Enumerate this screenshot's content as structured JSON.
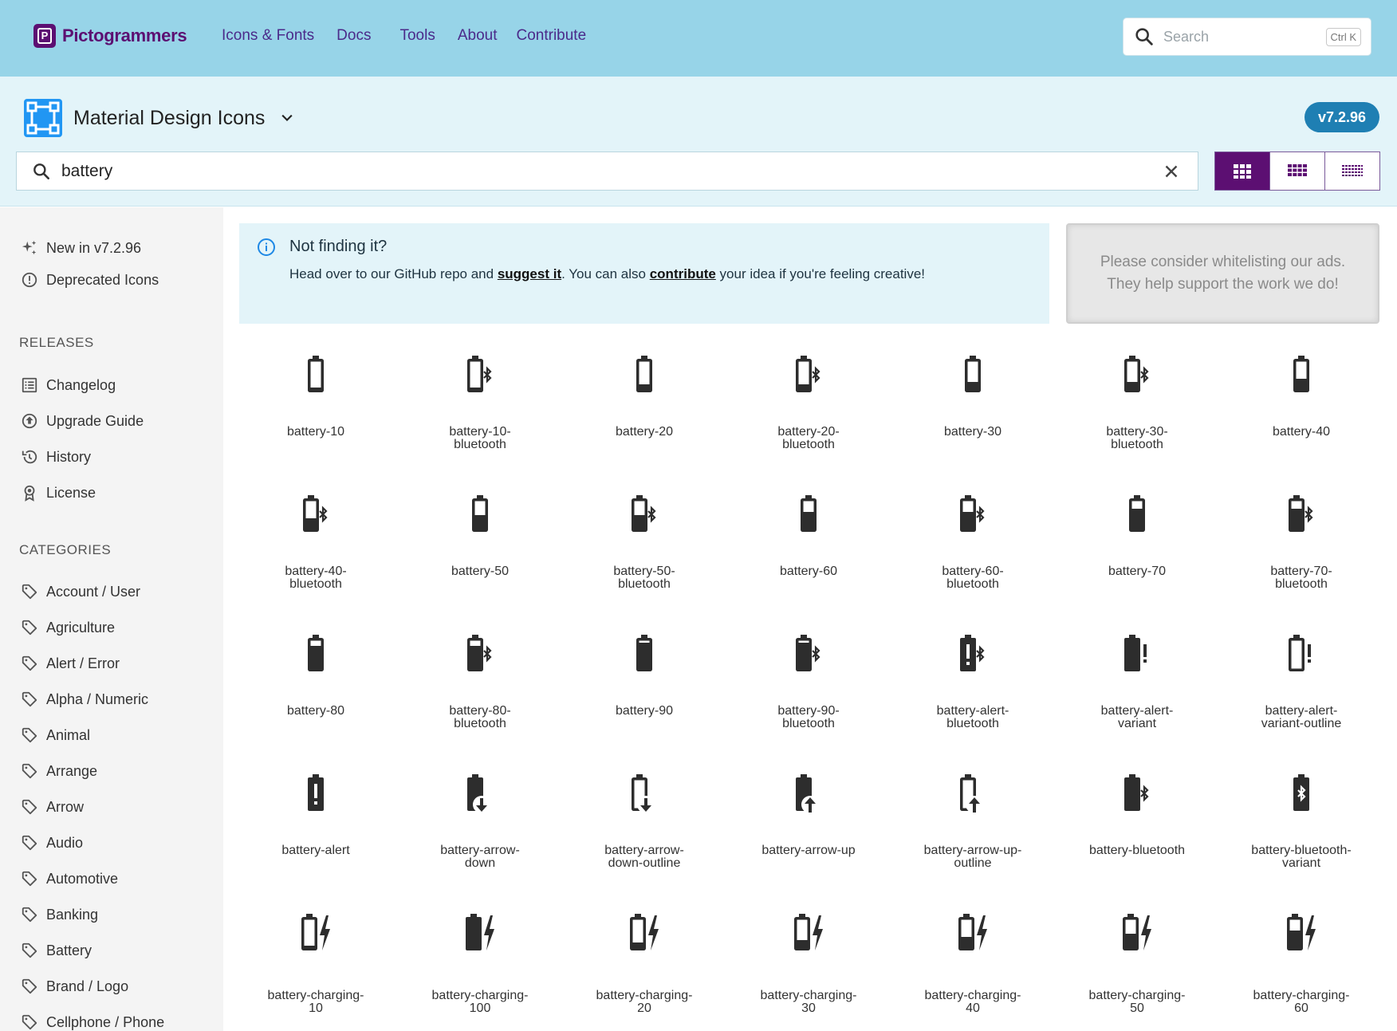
{
  "topbar": {
    "brand": "Pictogrammers",
    "nav": [
      "Icons & Fonts",
      "Docs",
      "Tools",
      "About",
      "Contribute"
    ],
    "search_placeholder": "Search",
    "search_shortcut": "Ctrl K"
  },
  "library": {
    "name": "Material Design Icons",
    "version": "v7.2.96",
    "search_value": "battery",
    "view_modes": [
      "large-grid",
      "medium-grid",
      "small-grid"
    ],
    "active_view": "large-grid"
  },
  "sidebar": {
    "top_items": [
      {
        "label": "New in v7.2.96",
        "icon": "sparkle-icon"
      },
      {
        "label": "Deprecated Icons",
        "icon": "alert-circle-icon"
      }
    ],
    "releases_heading": "RELEASES",
    "releases": [
      {
        "label": "Changelog",
        "icon": "list-icon"
      },
      {
        "label": "Upgrade Guide",
        "icon": "upgrade-icon"
      },
      {
        "label": "History",
        "icon": "history-icon"
      },
      {
        "label": "License",
        "icon": "license-icon"
      }
    ],
    "categories_heading": "CATEGORIES",
    "categories": [
      "Account / User",
      "Agriculture",
      "Alert / Error",
      "Alpha / Numeric",
      "Animal",
      "Arrange",
      "Arrow",
      "Audio",
      "Automotive",
      "Banking",
      "Battery",
      "Brand / Logo",
      "Cellphone / Phone"
    ]
  },
  "notice": {
    "title": "Not finding it?",
    "body_pre": "Head over to our GitHub repo and ",
    "link1": "suggest it",
    "body_mid": ". You can also ",
    "link2": "contribute",
    "body_post": " your idea if you're feeling creative!"
  },
  "ad": {
    "line1": "Please consider whitelisting our ads.",
    "line2": "They help support the work we do!"
  },
  "icons": [
    {
      "l1": "battery-10",
      "l2": "",
      "kind": "battery",
      "level": 1,
      "extra": ""
    },
    {
      "l1": "battery-10-",
      "l2": "bluetooth",
      "kind": "battery",
      "level": 1,
      "extra": "bt"
    },
    {
      "l1": "battery-20",
      "l2": "",
      "kind": "battery",
      "level": 2,
      "extra": ""
    },
    {
      "l1": "battery-20-",
      "l2": "bluetooth",
      "kind": "battery",
      "level": 2,
      "extra": "bt"
    },
    {
      "l1": "battery-30",
      "l2": "",
      "kind": "battery",
      "level": 3,
      "extra": ""
    },
    {
      "l1": "battery-30-",
      "l2": "bluetooth",
      "kind": "battery",
      "level": 3,
      "extra": "bt"
    },
    {
      "l1": "battery-40",
      "l2": "",
      "kind": "battery",
      "level": 4,
      "extra": ""
    },
    {
      "l1": "battery-40-",
      "l2": "bluetooth",
      "kind": "battery",
      "level": 4,
      "extra": "bt"
    },
    {
      "l1": "battery-50",
      "l2": "",
      "kind": "battery",
      "level": 5,
      "extra": ""
    },
    {
      "l1": "battery-50-",
      "l2": "bluetooth",
      "kind": "battery",
      "level": 5,
      "extra": "bt"
    },
    {
      "l1": "battery-60",
      "l2": "",
      "kind": "battery",
      "level": 6,
      "extra": ""
    },
    {
      "l1": "battery-60-",
      "l2": "bluetooth",
      "kind": "battery",
      "level": 6,
      "extra": "bt"
    },
    {
      "l1": "battery-70",
      "l2": "",
      "kind": "battery",
      "level": 7,
      "extra": ""
    },
    {
      "l1": "battery-70-",
      "l2": "bluetooth",
      "kind": "battery",
      "level": 7,
      "extra": "bt"
    },
    {
      "l1": "battery-80",
      "l2": "",
      "kind": "battery",
      "level": 8,
      "extra": ""
    },
    {
      "l1": "battery-80-",
      "l2": "bluetooth",
      "kind": "battery",
      "level": 8,
      "extra": "bt"
    },
    {
      "l1": "battery-90",
      "l2": "",
      "kind": "battery",
      "level": 9,
      "extra": ""
    },
    {
      "l1": "battery-90-",
      "l2": "bluetooth",
      "kind": "battery",
      "level": 9,
      "extra": "bt"
    },
    {
      "l1": "battery-alert-",
      "l2": "bluetooth",
      "kind": "alert",
      "level": 10,
      "extra": "bt"
    },
    {
      "l1": "battery-alert-",
      "l2": "variant",
      "kind": "battery",
      "level": 10,
      "extra": "excl"
    },
    {
      "l1": "battery-alert-",
      "l2": "variant-outline",
      "kind": "battery",
      "level": 0,
      "extra": "excl"
    },
    {
      "l1": "battery-alert",
      "l2": "",
      "kind": "alert",
      "level": 10,
      "extra": ""
    },
    {
      "l1": "battery-arrow-",
      "l2": "down",
      "kind": "battery",
      "level": 10,
      "extra": "down"
    },
    {
      "l1": "battery-arrow-",
      "l2": "down-outline",
      "kind": "battery",
      "level": 0,
      "extra": "down"
    },
    {
      "l1": "battery-arrow-up",
      "l2": "",
      "kind": "battery",
      "level": 10,
      "extra": "up"
    },
    {
      "l1": "battery-arrow-up-",
      "l2": "outline",
      "kind": "battery",
      "level": 0,
      "extra": "up"
    },
    {
      "l1": "battery-bluetooth",
      "l2": "",
      "kind": "battery",
      "level": 10,
      "extra": "bt"
    },
    {
      "l1": "battery-bluetooth-",
      "l2": "variant",
      "kind": "btvariant",
      "level": 10,
      "extra": ""
    },
    {
      "l1": "battery-charging-",
      "l2": "10",
      "kind": "charging",
      "level": 1,
      "extra": ""
    },
    {
      "l1": "battery-charging-",
      "l2": "100",
      "kind": "charging",
      "level": 10,
      "extra": ""
    },
    {
      "l1": "battery-charging-",
      "l2": "20",
      "kind": "charging",
      "level": 2,
      "extra": ""
    },
    {
      "l1": "battery-charging-",
      "l2": "30",
      "kind": "charging",
      "level": 3,
      "extra": ""
    },
    {
      "l1": "battery-charging-",
      "l2": "40",
      "kind": "charging",
      "level": 4,
      "extra": ""
    },
    {
      "l1": "battery-charging-",
      "l2": "50",
      "kind": "charging",
      "level": 5,
      "extra": ""
    },
    {
      "l1": "battery-charging-",
      "l2": "60",
      "kind": "charging",
      "level": 6,
      "extra": ""
    }
  ]
}
